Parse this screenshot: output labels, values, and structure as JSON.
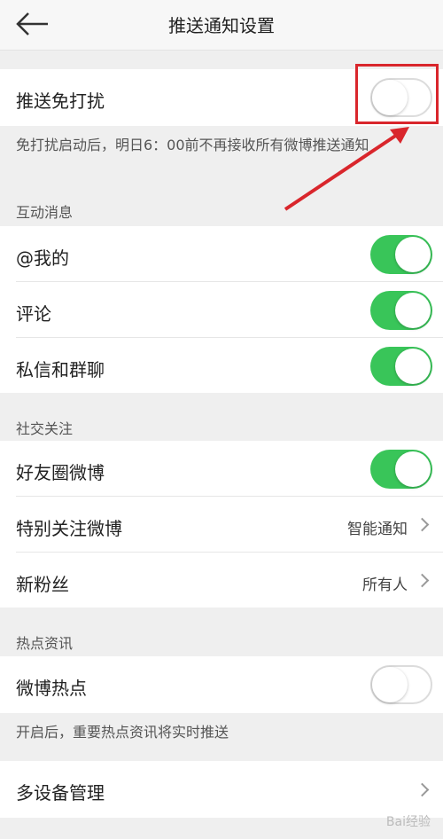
{
  "header": {
    "title": "推送通知设置",
    "back_icon": "back-arrow-icon"
  },
  "dnd": {
    "label": "推送免打扰",
    "enabled": false,
    "hint": "免打扰启动后，明日6：00前不再接收所有微博推送通知"
  },
  "interaction": {
    "section_title": "互动消息",
    "items": [
      {
        "label": "@我的",
        "enabled": true
      },
      {
        "label": "评论",
        "enabled": true
      },
      {
        "label": "私信和群聊",
        "enabled": true
      }
    ]
  },
  "social": {
    "section_title": "社交关注",
    "friends_circle": {
      "label": "好友圈微博",
      "enabled": true
    },
    "special_follow": {
      "label": "特别关注微博",
      "value": "智能通知"
    },
    "new_fans": {
      "label": "新粉丝",
      "value": "所有人"
    }
  },
  "hot": {
    "section_title": "热点资讯",
    "weibo_hot": {
      "label": "微博热点",
      "enabled": false
    },
    "hint": "开启后，重要热点资讯将实时推送"
  },
  "multi_device": {
    "label": "多设备管理"
  },
  "watermark": "Bai经验",
  "colors": {
    "toggle_on": "#39c559",
    "annotation": "#d9262c"
  }
}
